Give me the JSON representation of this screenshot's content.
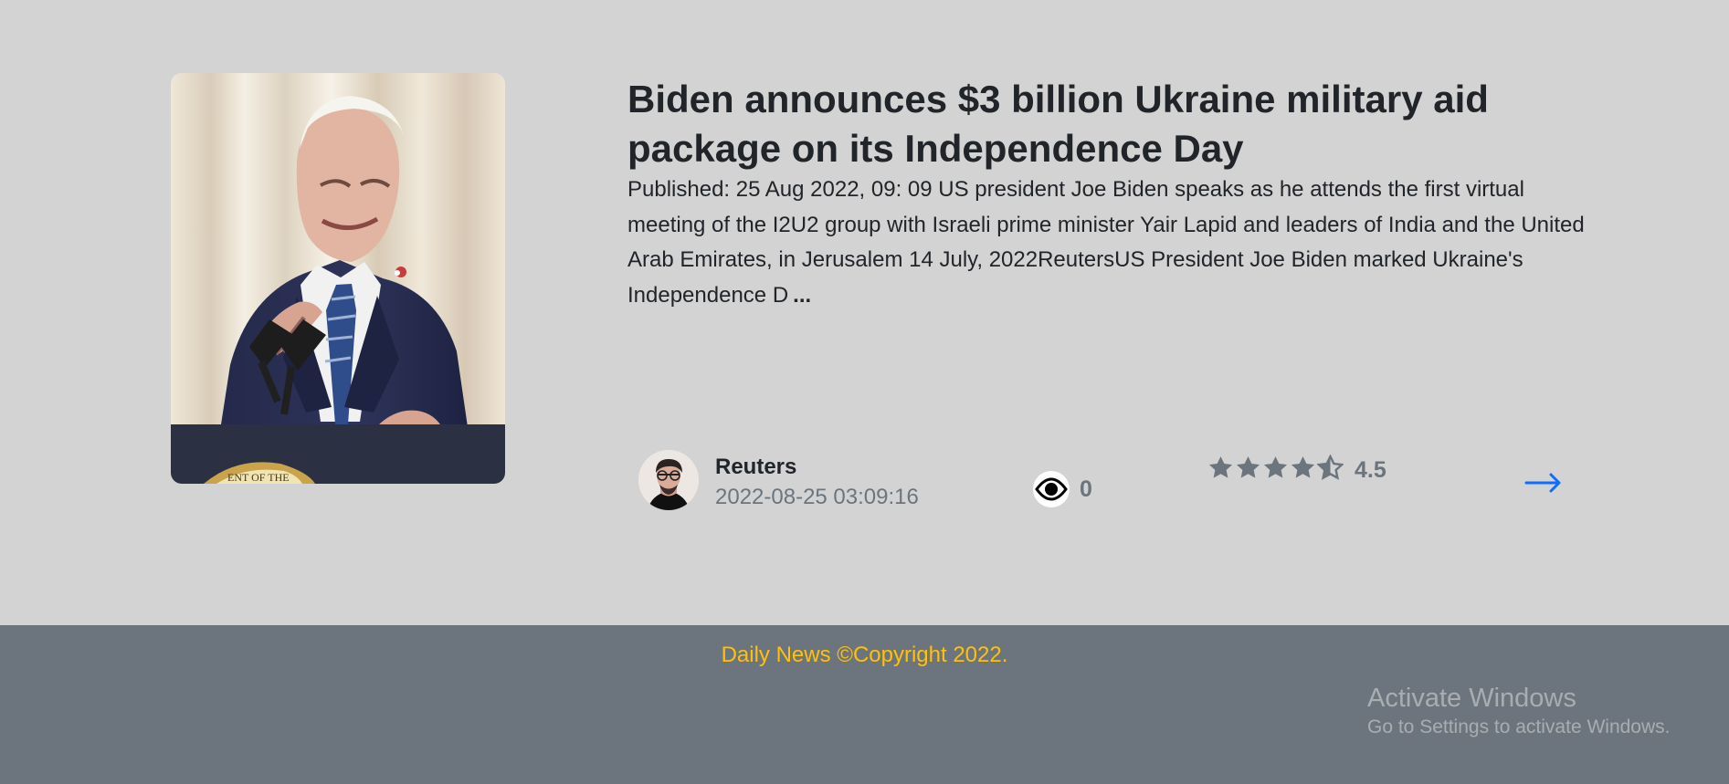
{
  "article": {
    "title": "Biden announces $3 billion Ukraine military aid package on its Independence Day",
    "summary": "Published: 25 Aug 2022, 09: 09 US president Joe Biden speaks as he attends the first virtual meeting of the I2U2 group with Israeli prime minister Yair Lapid and leaders of India and the United Arab Emirates, in Jerusalem 14 July, 2022ReutersUS President Joe Biden marked Ukraine's Independence D",
    "ellipsis": "...",
    "author": {
      "name": "Reuters",
      "date": "2022-08-25 03:09:16"
    },
    "views": "0",
    "rating": {
      "value": "4.5",
      "stars": 4.5
    },
    "next_icon": "right-arrow-icon"
  },
  "footer": {
    "copyright": "Daily News ©Copyright 2022."
  },
  "watermark": {
    "title": "Activate Windows",
    "subtitle": "Go to Settings to activate Windows."
  },
  "colors": {
    "page_background": "#d3d3d3",
    "footer_background": "#6c757d",
    "accent_text": "#ffc107",
    "muted_text": "#6c757d",
    "link_arrow": "#0d6efd"
  }
}
